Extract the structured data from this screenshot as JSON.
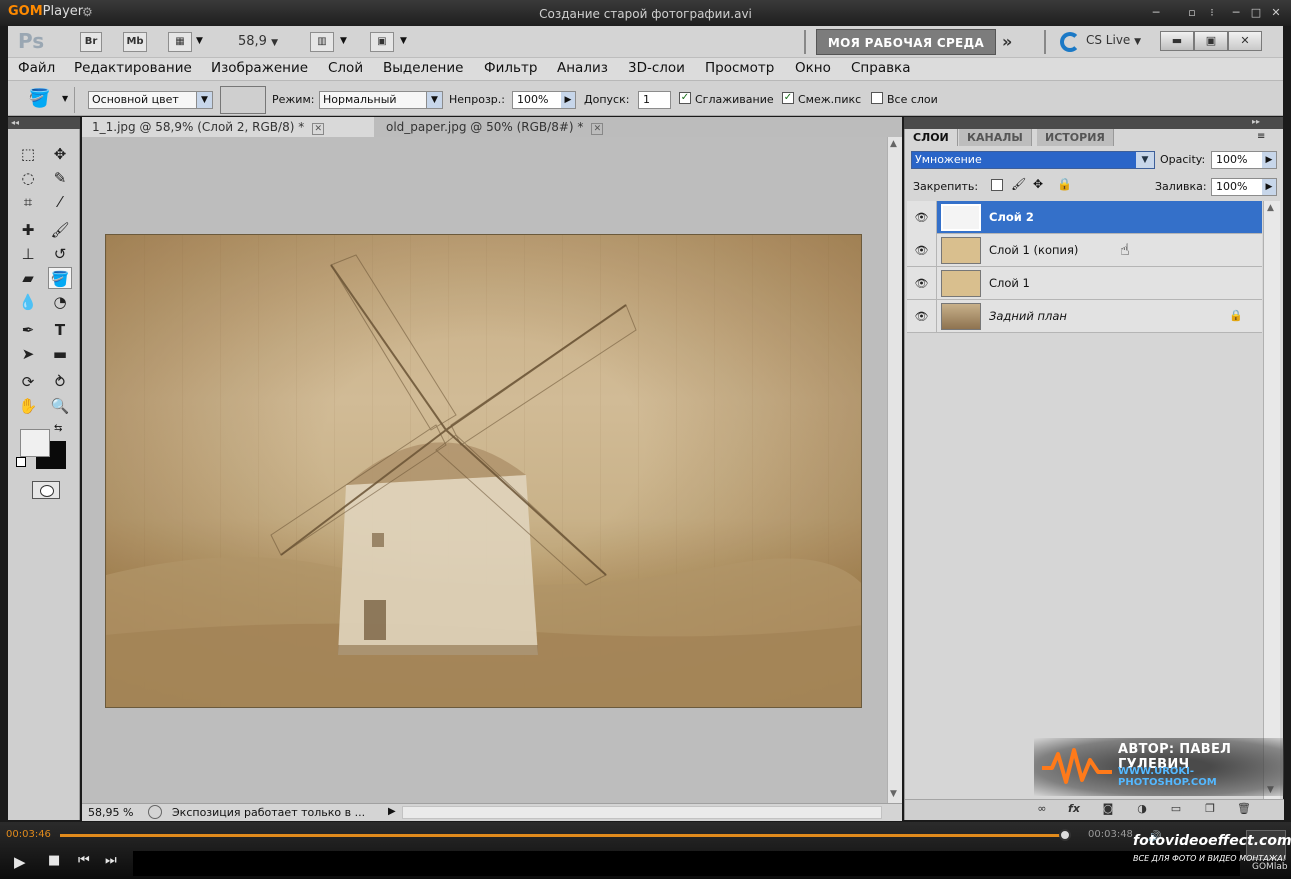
{
  "gom": {
    "logo_a": "GOM",
    "logo_b": "Player",
    "file_title": "Создание старой фотографии.avi",
    "time_current": "00:03:46",
    "time_total": "00:03:48",
    "progress": 0.995,
    "brand": "fotovideoeffect.com",
    "brand_sub": "ВСЕ ДЛЯ ФОТО И ВИДЕО МОНТАЖА!",
    "gomlab": "GOMlab"
  },
  "ps": {
    "logo": "Ps",
    "app_icons": [
      "Br",
      "Mb"
    ],
    "zoom": "58,9",
    "workspace": "МОЯ РАБОЧАЯ СРЕДА",
    "cslive": "CS Live",
    "menu": [
      "Файл",
      "Редактирование",
      "Изображение",
      "Слой",
      "Выделение",
      "Фильтр",
      "Анализ",
      "3D-слои",
      "Просмотр",
      "Окно",
      "Справка"
    ],
    "options": {
      "fill_source": "Основной цвет",
      "mode_label": "Режим:",
      "mode_value": "Нормальный",
      "opacity_label": "Непрозр.:",
      "opacity_value": "100%",
      "tolerance_label": "Допуск:",
      "tolerance_value": "1",
      "antialias_label": "Сглаживание",
      "contiguous_label": "Смеж.пикс",
      "all_layers_label": "Все слои"
    },
    "doc_tabs": [
      {
        "label": "1_1.jpg @ 58,9% (Слой 2, RGB/8) *"
      },
      {
        "label": "old_paper.jpg @ 50% (RGB/8#) *"
      }
    ],
    "status": {
      "zoom": "58,95 %",
      "info": "Экспозиция работает только в ..."
    },
    "layers_panel": {
      "tabs": [
        "СЛОИ",
        "КАНАЛЫ",
        "ИСТОРИЯ"
      ],
      "blend_mode": "Умножение",
      "opacity_label": "Opacity:",
      "opacity_value": "100%",
      "lock_label": "Закрепить:",
      "fill_label": "Заливка:",
      "fill_value": "100%",
      "layers": [
        {
          "name": "Слой 2",
          "selected": true,
          "thumb": "#f4f4f4"
        },
        {
          "name": "Слой 1 (копия)",
          "selected": false,
          "thumb": "#d9bf8e"
        },
        {
          "name": "Слой 1",
          "selected": false,
          "thumb": "#d9bf8e"
        },
        {
          "name": "Задний план",
          "selected": false,
          "thumb": "#a98c60"
        }
      ]
    }
  },
  "watermark": {
    "author": "АВТОР: ПАВЕЛ ГУЛЕВИЧ",
    "url": "WWW.UROKI-PHOTOSHOP.COM"
  },
  "colors": {
    "accent_blue": "#3470c9",
    "gom_orange": "#e08a1c"
  }
}
